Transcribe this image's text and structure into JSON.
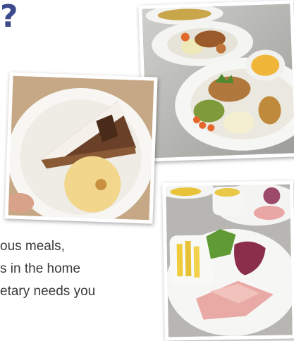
{
  "heading": {
    "question_mark": "?"
  },
  "body_lines": [
    "ous meals,",
    "s in the home",
    "etary needs you"
  ],
  "photos": [
    {
      "name": "photo-plates",
      "icon": "roast-dinner-plates-photo"
    },
    {
      "name": "photo-cake",
      "icon": "chocolate-cake-with-ice-cream-photo"
    },
    {
      "name": "photo-ham",
      "icon": "ham-salad-and-chips-plate-photo"
    }
  ],
  "colors": {
    "heading": "#3c4a8c",
    "text": "#3a3a3a"
  }
}
